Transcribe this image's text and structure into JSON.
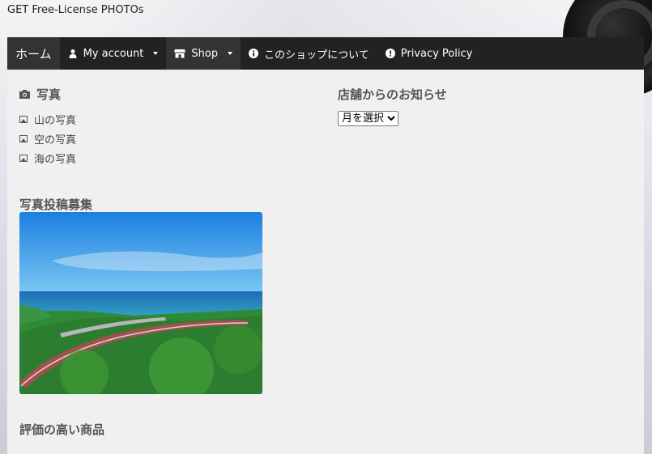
{
  "site": {
    "title": "GET Free-License PHOTOs"
  },
  "nav": {
    "items": [
      {
        "label": "ホーム",
        "icon": ""
      },
      {
        "label": "My account",
        "icon": "user-icon"
      },
      {
        "label": "Shop",
        "icon": "store-icon"
      },
      {
        "label": "このショップについて",
        "icon": "info-icon"
      },
      {
        "label": "Privacy Policy",
        "icon": "alert-icon"
      }
    ]
  },
  "categories": {
    "title": "写真",
    "items": [
      "山の写真",
      "空の写真",
      "海の写真"
    ]
  },
  "notices": {
    "title": "店舗からのお知らせ",
    "select_value": "月を選択"
  },
  "submission": {
    "title": "写真投稿募集"
  },
  "top_rated": {
    "title": "評価の高い商品"
  }
}
